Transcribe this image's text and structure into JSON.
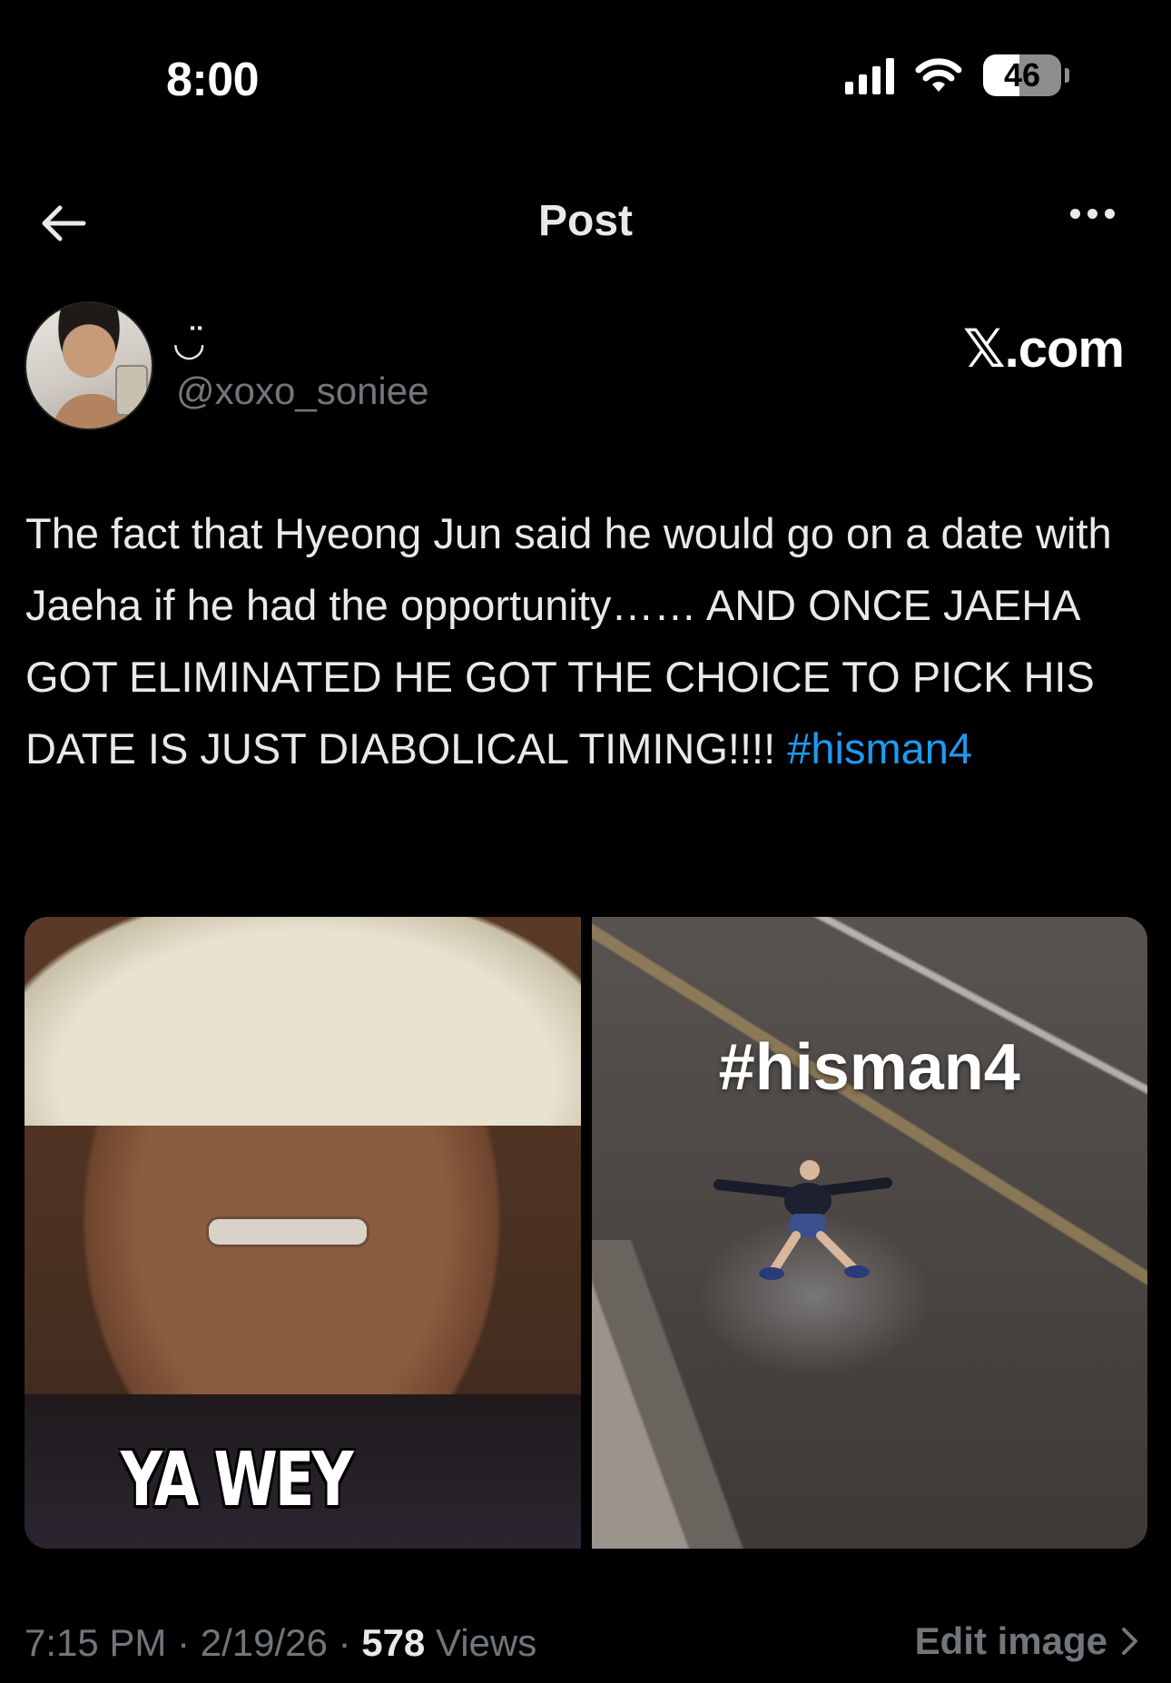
{
  "status_bar": {
    "time": "8:00",
    "battery_percent": "46",
    "battery_level": 0.46
  },
  "header": {
    "title": "Post"
  },
  "author": {
    "display_name": "◡̈",
    "handle": "@xoxo_soniee"
  },
  "watermark": {
    "text": "𝕏.com"
  },
  "tweet": {
    "text": "The fact that Hyeong Jun said he would go on a date with Jaeha if he had the opportunity…… AND ONCE JAEHA GOT ELIMINATED HE GOT THE CHOICE TO PICK HIS DATE IS JUST DIABOLICAL TIMING!!!! ",
    "hashtag": "#hisman4"
  },
  "media": {
    "left_caption": "YA WEY",
    "right_overlay": "#hisman4"
  },
  "footer": {
    "time": "7:15 PM",
    "sep1": " · ",
    "date": "2/19/26",
    "sep2": " · ",
    "views_count": "578",
    "views_label": " Views",
    "edit_label": "Edit image"
  },
  "colors": {
    "background": "#000000",
    "text": "#e7e9ea",
    "secondary": "#71767b",
    "link": "#1d9bf0"
  }
}
